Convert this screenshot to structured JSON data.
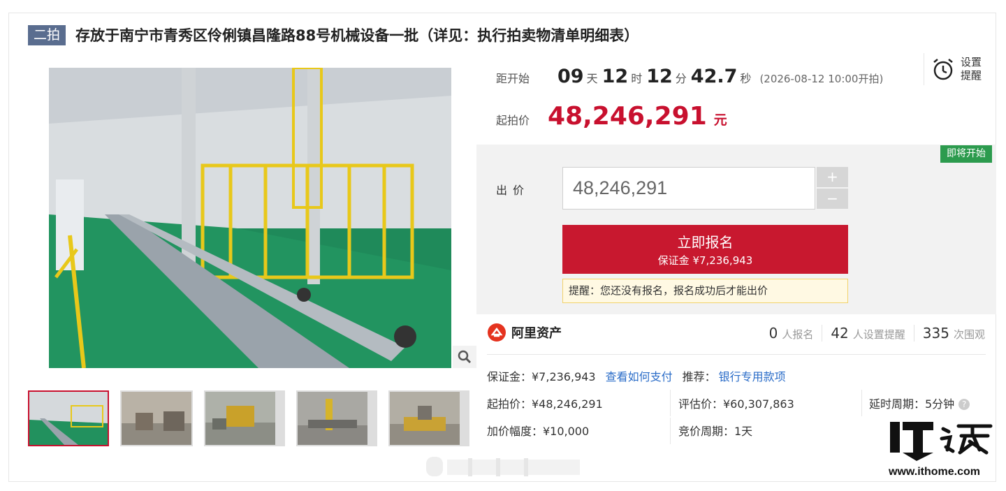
{
  "header": {
    "round_tag": "二拍",
    "title": "存放于南宁市青秀区伶俐镇昌隆路88号机械设备一批（详见：执行拍卖物清单明细表）"
  },
  "countdown": {
    "label": "距开始",
    "days": "09",
    "days_unit": "天",
    "hours": "12",
    "hours_unit": "时",
    "minutes": "12",
    "minutes_unit": "分",
    "seconds": "42.7",
    "seconds_unit": "秒",
    "start_note": "(2026-08-12 10:00开拍)"
  },
  "reminder": {
    "label": "设置提醒",
    "icon": "alarm-clock-icon"
  },
  "start_price": {
    "label": "起拍价",
    "value": "48,246,291",
    "unit": "元"
  },
  "bid": {
    "status_badge": "即将开始",
    "label": "出价",
    "input_value": "48,246,291",
    "plus": "+",
    "minus": "−",
    "signup_button": "立即报名",
    "signup_deposit": "保证金 ¥7,236,943",
    "notice": "提醒：您还没有报名，报名成功后才能出价"
  },
  "stats": {
    "brand": "阿里资产",
    "signups": "0",
    "signups_unit": "人报名",
    "reminders": "42",
    "reminders_unit": "人设置提醒",
    "views": "335",
    "views_unit": "次围观"
  },
  "details": {
    "deposit": "保证金：¥7,236,943",
    "how_to_pay": "查看如何支付",
    "recommend_label": "推荐：",
    "recommend_link": "银行专用款项",
    "start_price": "起拍价：¥48,246,291",
    "appraisal": "评估价：¥60,307,863",
    "delay": "延时周期：5分钟",
    "increment": "加价幅度：¥10,000",
    "bid_period": "竞价周期：1天"
  },
  "watermark": {
    "logo_text": "IT之家",
    "url": "www.ithome.com"
  },
  "colors": {
    "accent_red": "#c8102e",
    "badge_green": "#2c9b4e",
    "tag_blue": "#5a6d8f",
    "link_blue": "#2a6cc8"
  }
}
